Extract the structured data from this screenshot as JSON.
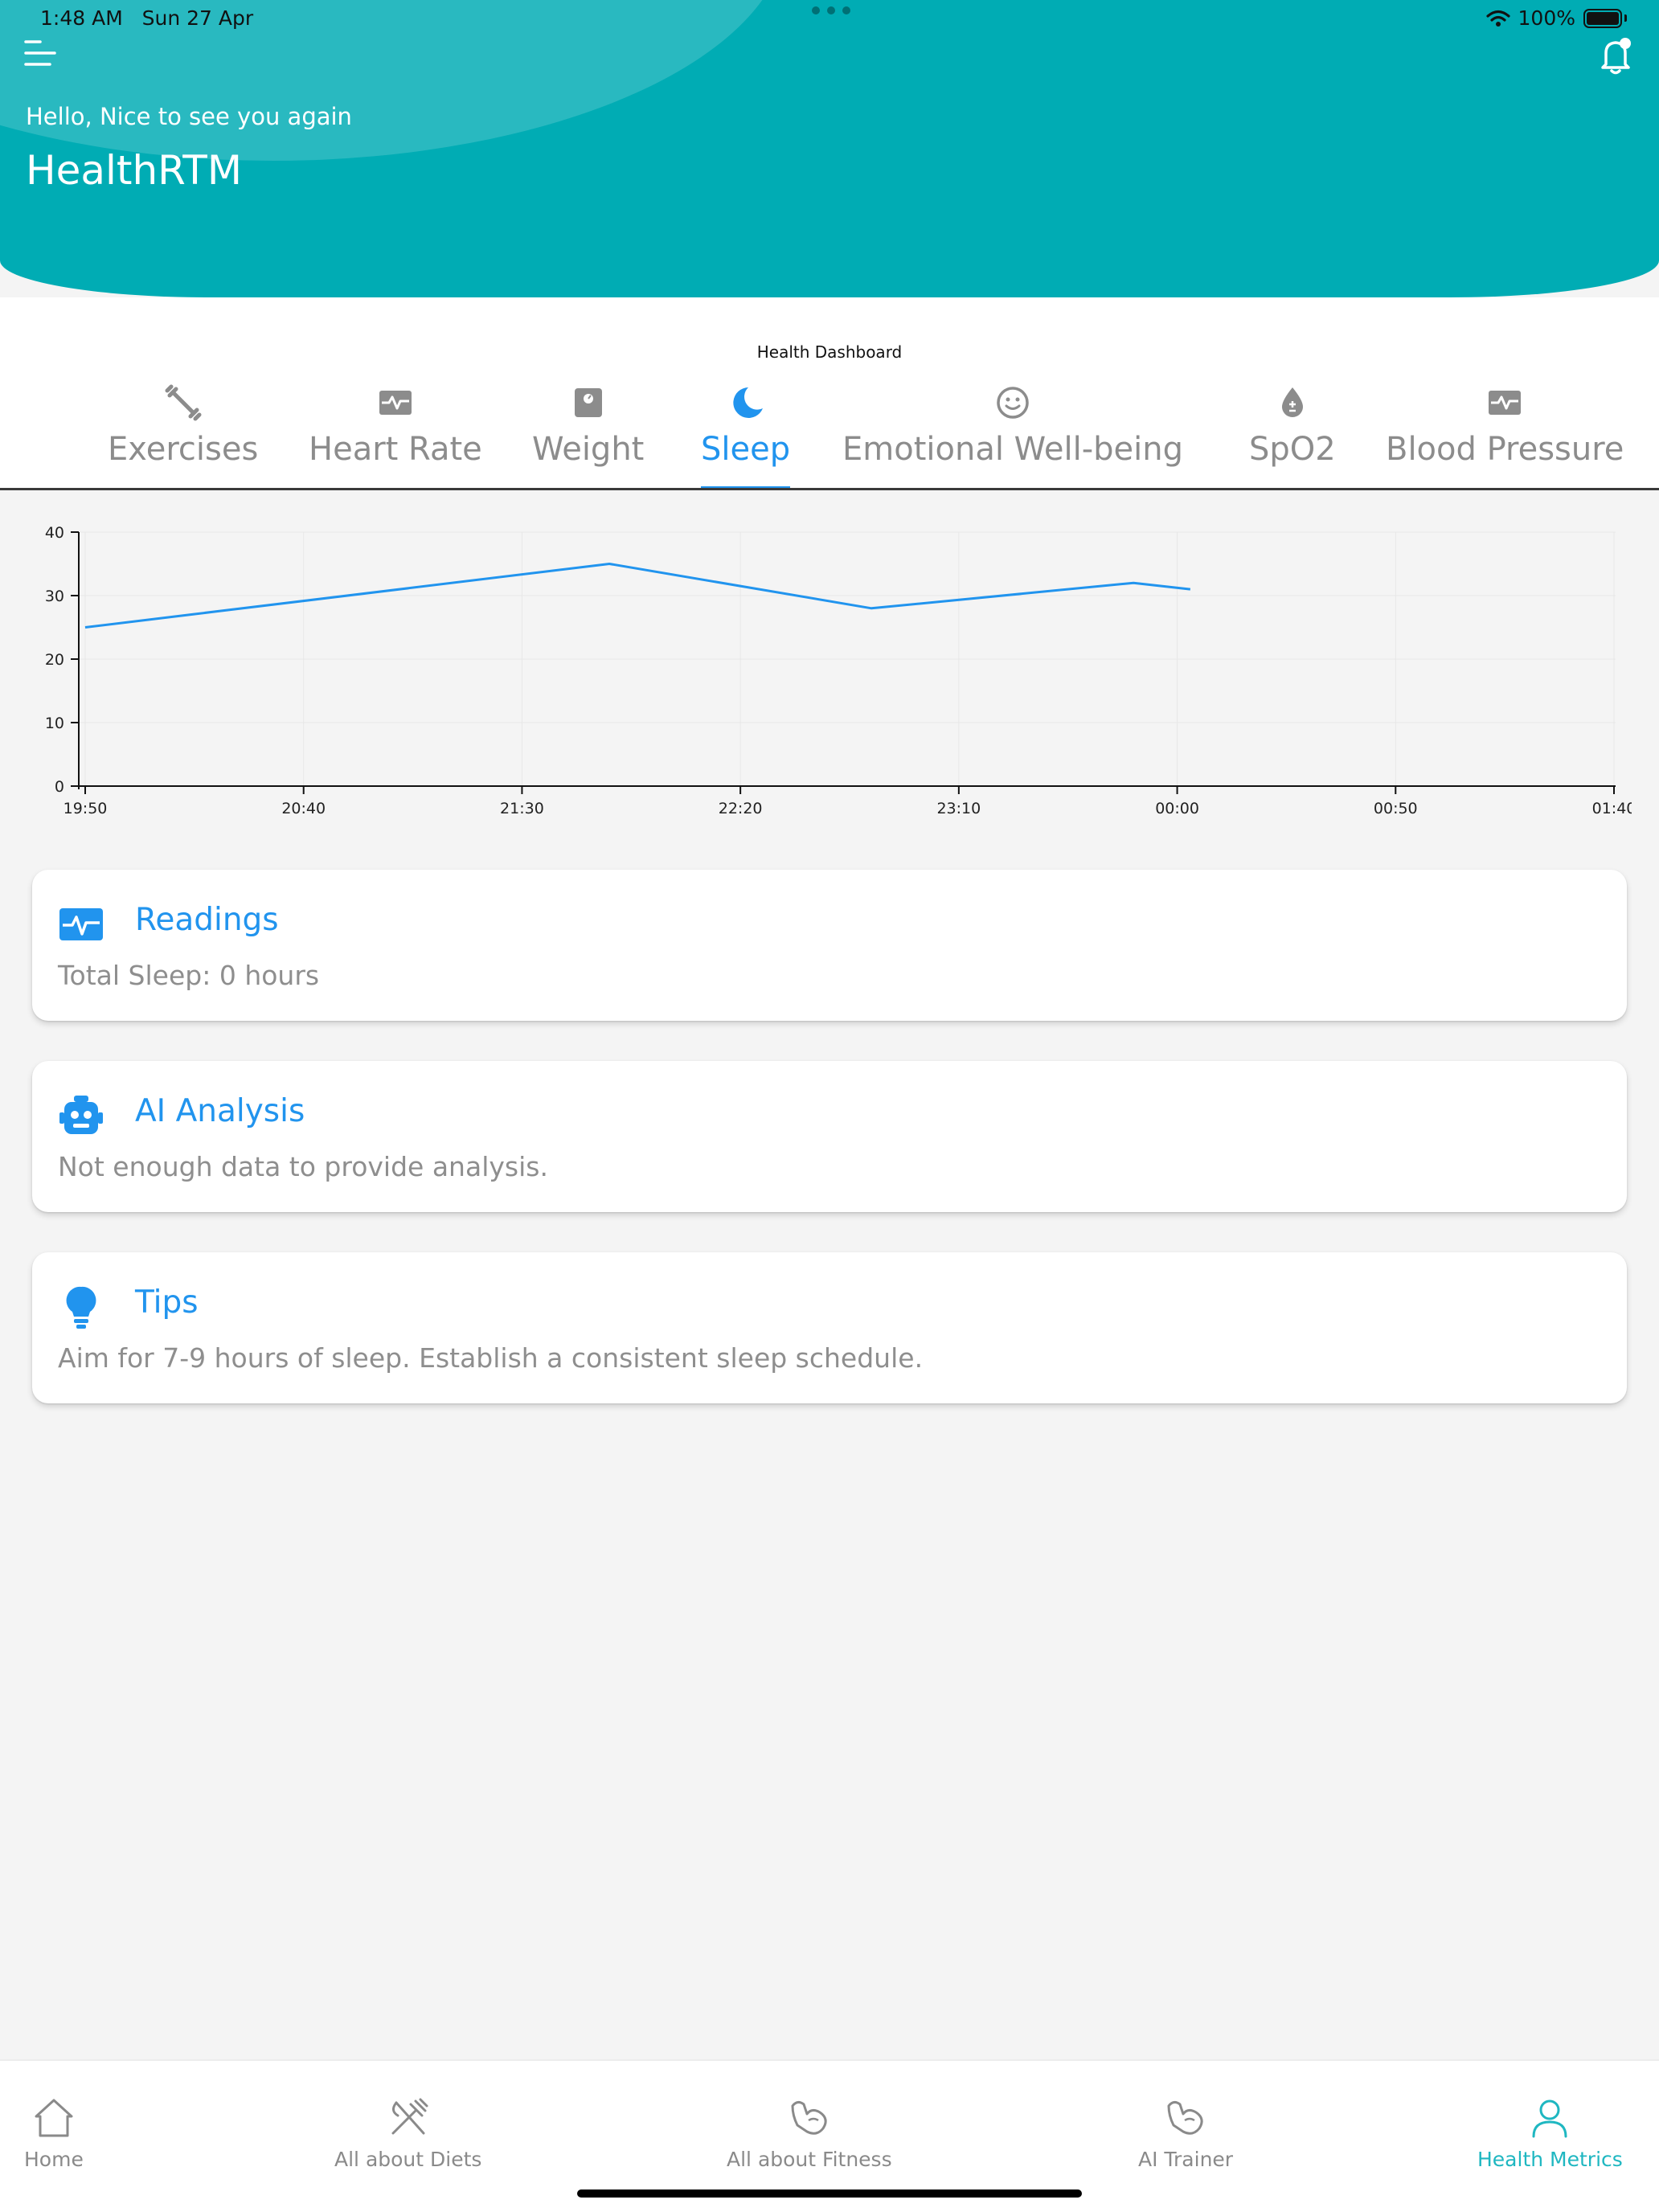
{
  "status_bar": {
    "time": "1:48 AM",
    "date": "Sun 27 Apr",
    "battery": "100%"
  },
  "header": {
    "greeting": "Hello, Nice to see you again",
    "app_name": "HealthRTM",
    "accent_color": "#00acb4"
  },
  "dashboard": {
    "title": "Health Dashboard",
    "active_color": "#2194ee",
    "tabs": [
      {
        "label": "Exercises",
        "icon": "dumbbell-icon"
      },
      {
        "label": "Heart Rate",
        "icon": "heart-monitor-icon"
      },
      {
        "label": "Weight",
        "icon": "scale-icon"
      },
      {
        "label": "Sleep",
        "icon": "moon-icon",
        "active": true
      },
      {
        "label": "Emotional Well-being",
        "icon": "smiley-icon"
      },
      {
        "label": "SpO2",
        "icon": "blood-drop-icon"
      },
      {
        "label": "Blood Pressure",
        "icon": "monitor-pulse-icon"
      }
    ]
  },
  "chart_data": {
    "type": "line",
    "x_ticks": [
      "19:50",
      "20:40",
      "21:30",
      "22:20",
      "23:10",
      "00:00",
      "00:50",
      "01:40"
    ],
    "y_ticks": [
      0,
      10,
      20,
      30,
      40
    ],
    "ylim": [
      0,
      40
    ],
    "grid": true,
    "series": [
      {
        "color": "#2194ee",
        "points": [
          {
            "x": "19:50",
            "y": 25
          },
          {
            "x": "21:50",
            "y": 35
          },
          {
            "x": "22:50",
            "y": 28
          },
          {
            "x": "23:50",
            "y": 32
          },
          {
            "x": "00:03",
            "y": 31
          }
        ]
      }
    ]
  },
  "cards": {
    "readings": {
      "title": "Readings",
      "body": "Total Sleep: 0 hours",
      "icon": "pulse-monitor-icon"
    },
    "ai_analysis": {
      "title": "AI Analysis",
      "body": "Not enough data to provide analysis.",
      "icon": "robot-icon"
    },
    "tips": {
      "title": "Tips",
      "body": "Aim for 7-9 hours of sleep. Establish a consistent sleep schedule.",
      "icon": "lightbulb-icon"
    }
  },
  "bottom_nav": {
    "items": [
      {
        "label": "Home",
        "icon": "home-icon"
      },
      {
        "label": "All about Diets",
        "icon": "fork-knife-icon"
      },
      {
        "label": "All about Fitness",
        "icon": "flexed-arm-icon"
      },
      {
        "label": "AI Trainer",
        "icon": "flexed-arm-icon"
      },
      {
        "label": "Health Metrics",
        "icon": "person-icon",
        "active": true
      }
    ],
    "active_color": "#1fb7c1"
  }
}
